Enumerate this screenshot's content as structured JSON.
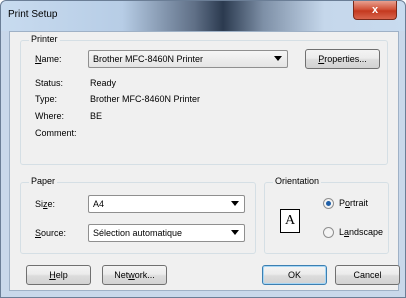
{
  "window": {
    "title": "Print Setup",
    "close_label": "x"
  },
  "printer": {
    "group_label": "Printer",
    "name_label_pre": "",
    "name_label_mn": "N",
    "name_label_post": "ame:",
    "name_value": "Brother MFC-8460N Printer",
    "properties_mn": "P",
    "properties_rest": "roperties...",
    "status_label": "Status:",
    "status_value": "Ready",
    "type_label": "Type:",
    "type_value": "Brother MFC-8460N Printer",
    "where_label": "Where:",
    "where_value": "BE",
    "comment_label": "Comment:"
  },
  "paper": {
    "group_label": "Paper",
    "size_pre": "Si",
    "size_mn": "z",
    "size_post": "e:",
    "size_value": "A4",
    "source_mn": "S",
    "source_post": "ource:",
    "source_value": "Sélection automatique"
  },
  "orientation": {
    "group_label": "Orientation",
    "icon_letter": "A",
    "portrait_pre": "P",
    "portrait_mn": "o",
    "portrait_post": "rtrait",
    "landscape_pre": "L",
    "landscape_mn": "a",
    "landscape_post": "ndscape",
    "selected": "Portrait"
  },
  "buttons": {
    "help_mn": "H",
    "help_post": "elp",
    "network_pre": "Net",
    "network_mn": "w",
    "network_post": "ork...",
    "ok": "OK",
    "cancel": "Cancel"
  }
}
